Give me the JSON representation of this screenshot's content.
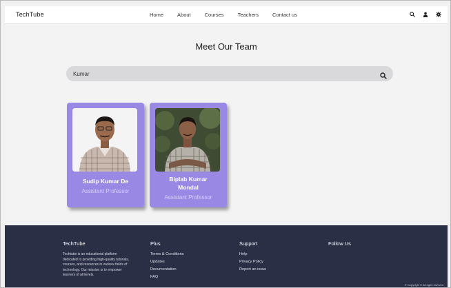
{
  "navbar": {
    "brand": "TechTube",
    "links": [
      "Home",
      "About",
      "Courses",
      "Teachers",
      "Contact us"
    ],
    "icons": [
      "search-icon",
      "user-icon",
      "settings-icon"
    ]
  },
  "main": {
    "title": "Meet Our Team",
    "search": {
      "value": "Kumar",
      "placeholder": ""
    },
    "cards": [
      {
        "name": "Sudip Kumar De",
        "role": "Assistant Professor"
      },
      {
        "name_line1": "Biplab Kumar",
        "name_line2": "Mondal",
        "role": "Assistant Professor"
      }
    ]
  },
  "footer": {
    "col1": {
      "heading": "TechTube",
      "text": "Techtube is an educational platform dedicated to providing high-quality tutorials, courses, and resources in various fields of technology. Our mission is to empower learners of all levels."
    },
    "col2": {
      "heading": "Plus",
      "links": [
        "Terms & Conditions",
        "Updates",
        "Documentation",
        "FAQ"
      ]
    },
    "col3": {
      "heading": "Support",
      "links": [
        "Help",
        "Privacy Policy",
        "Report an issue"
      ]
    },
    "col4": {
      "heading": "Follow Us"
    },
    "copyright": "© Copyright © All right reserved"
  },
  "colors": {
    "card": "#9a89e4",
    "footer": "#2a2f46",
    "search": "#d9d9dc"
  }
}
